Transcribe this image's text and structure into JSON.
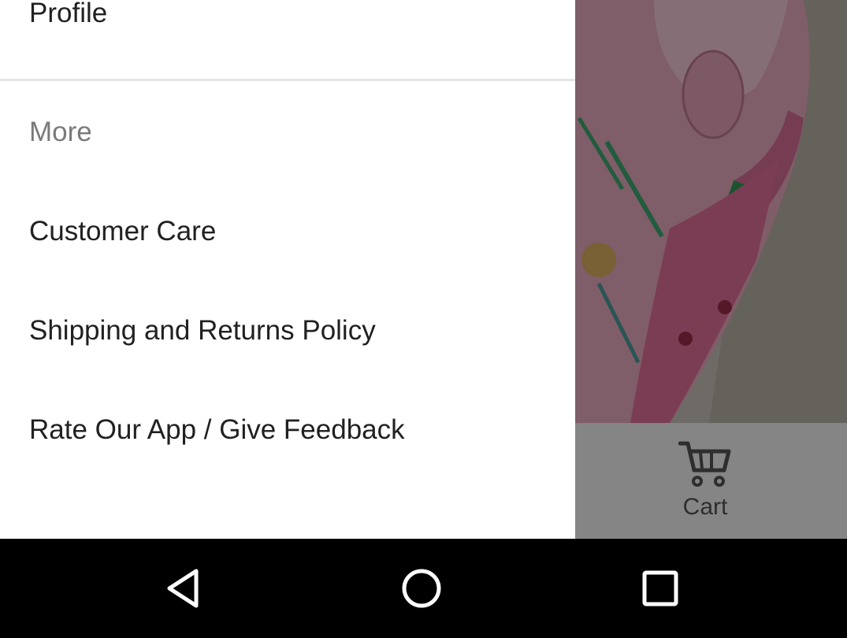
{
  "drawer": {
    "profile_label": "Profile",
    "section_header": "More",
    "items": [
      {
        "label": "Customer Care"
      },
      {
        "label": "Shipping and Returns Policy"
      },
      {
        "label": "Rate Our App / Give Feedback"
      }
    ]
  },
  "bottom_tabs": {
    "cart_label": "Cart",
    "cart_icon": "cart-icon"
  },
  "navbar": {
    "back_icon": "back-triangle-icon",
    "home_icon": "home-circle-icon",
    "recents_icon": "recents-square-icon"
  },
  "colors": {
    "drawer_bg": "#ffffff",
    "text_primary": "#212121",
    "text_secondary": "#7a7a7a",
    "navbar_bg": "#000000",
    "scrim": "rgba(0,0,0,0.45)"
  }
}
